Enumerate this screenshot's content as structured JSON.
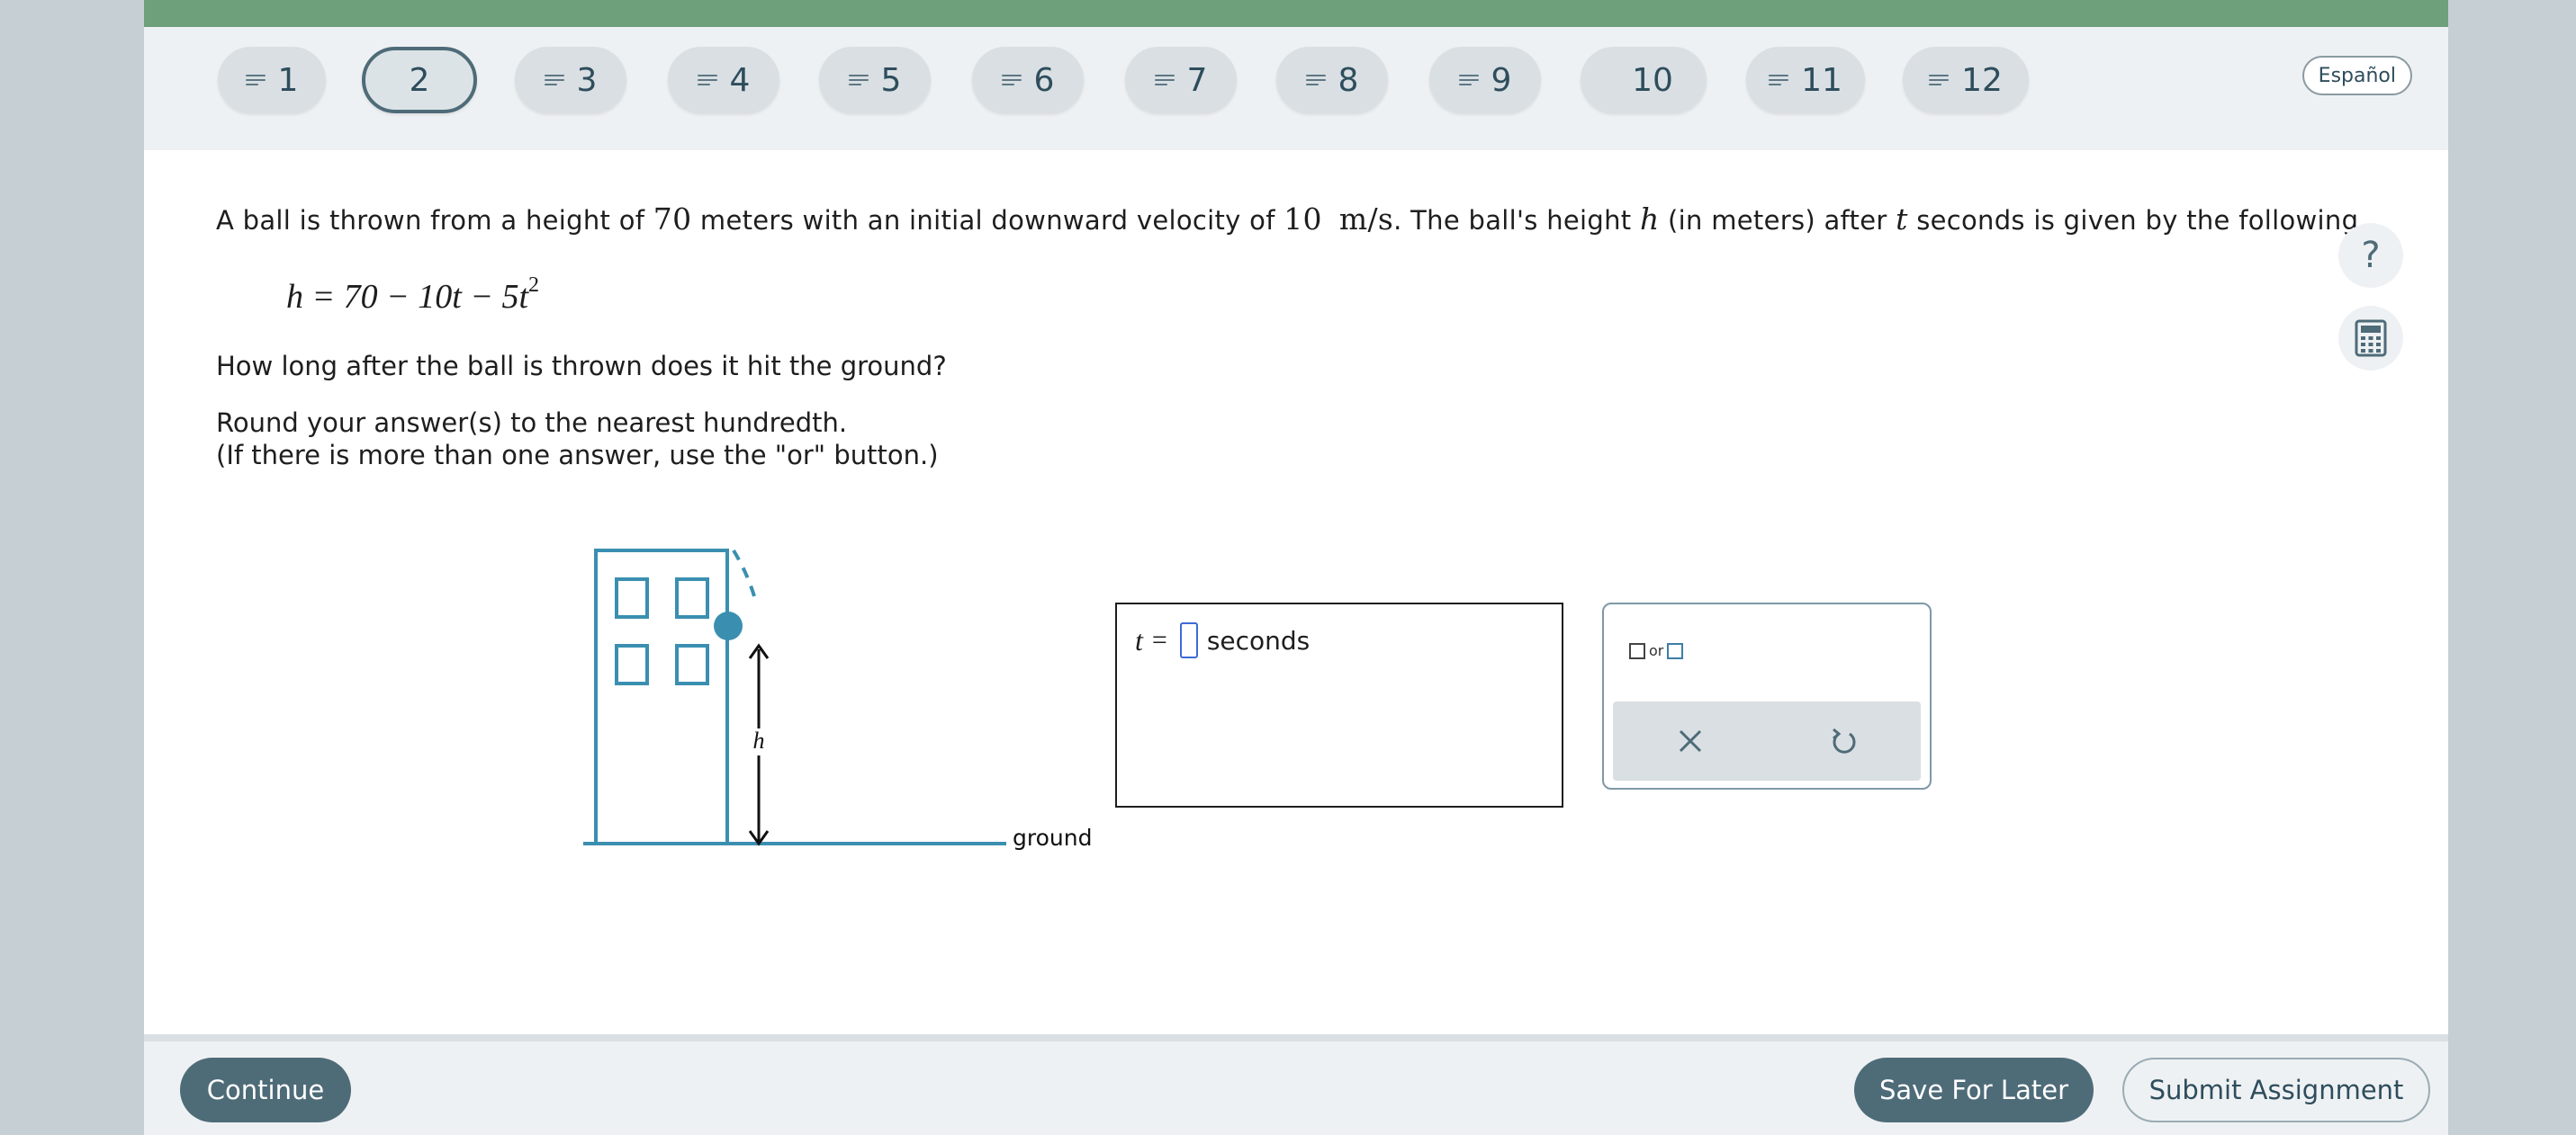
{
  "language_button": "Español",
  "questions": [
    {
      "label": "1",
      "icon": "lines-icon",
      "active": false
    },
    {
      "label": "2",
      "icon": null,
      "active": true
    },
    {
      "label": "3",
      "icon": "lines-icon",
      "active": false
    },
    {
      "label": "4",
      "icon": "lines-icon",
      "active": false
    },
    {
      "label": "5",
      "icon": "lines-icon",
      "active": false
    },
    {
      "label": "6",
      "icon": "lines-icon",
      "active": false
    },
    {
      "label": "7",
      "icon": "lines-icon",
      "active": false
    },
    {
      "label": "8",
      "icon": "lines-icon",
      "active": false
    },
    {
      "label": "9",
      "icon": "lines-icon",
      "active": false
    },
    {
      "label": "10",
      "icon": null,
      "active": false
    },
    {
      "label": "11",
      "icon": "lines-icon",
      "active": false
    },
    {
      "label": "12",
      "icon": "lines-icon",
      "active": false
    }
  ],
  "problem": {
    "p1": "A ball is thrown from a height of ",
    "height_value": "70",
    "p2": " meters with an initial downward velocity of ",
    "velocity_value": "10",
    "velocity_unit": "m/s",
    "p3": ". The ball's height ",
    "var_h": "h",
    "p4": " (in meters) after ",
    "var_t": "t",
    "p5": " seconds is given by the following.",
    "equation_lhs": "h = 70 − 10t − 5t",
    "equation_exp": "2",
    "question": "How long after the ball is thrown does it hit the ground?",
    "round_instruction": "Round your answer(s) to the nearest hundredth.",
    "or_instruction": "(If there is more than one answer, use the \"or\" button.)"
  },
  "diagram": {
    "height_label": "h",
    "ground_label": "ground"
  },
  "answer": {
    "variable": "t",
    "equals": "=",
    "value": "",
    "unit": "seconds"
  },
  "keypad": {
    "or_label": "or",
    "clear_icon": "close-icon",
    "undo_icon": "undo-icon"
  },
  "side_tools": {
    "help_icon": "help-icon",
    "calculator_icon": "calculator-icon",
    "help_glyph": "?"
  },
  "footer": {
    "continue_label": "Continue",
    "save_label": "Save For Later",
    "submit_label": "Submit Assignment"
  },
  "colors": {
    "top_bar": "#6ea07c",
    "accent_dark": "#4e6b78",
    "diagram": "#3a8fb0"
  }
}
